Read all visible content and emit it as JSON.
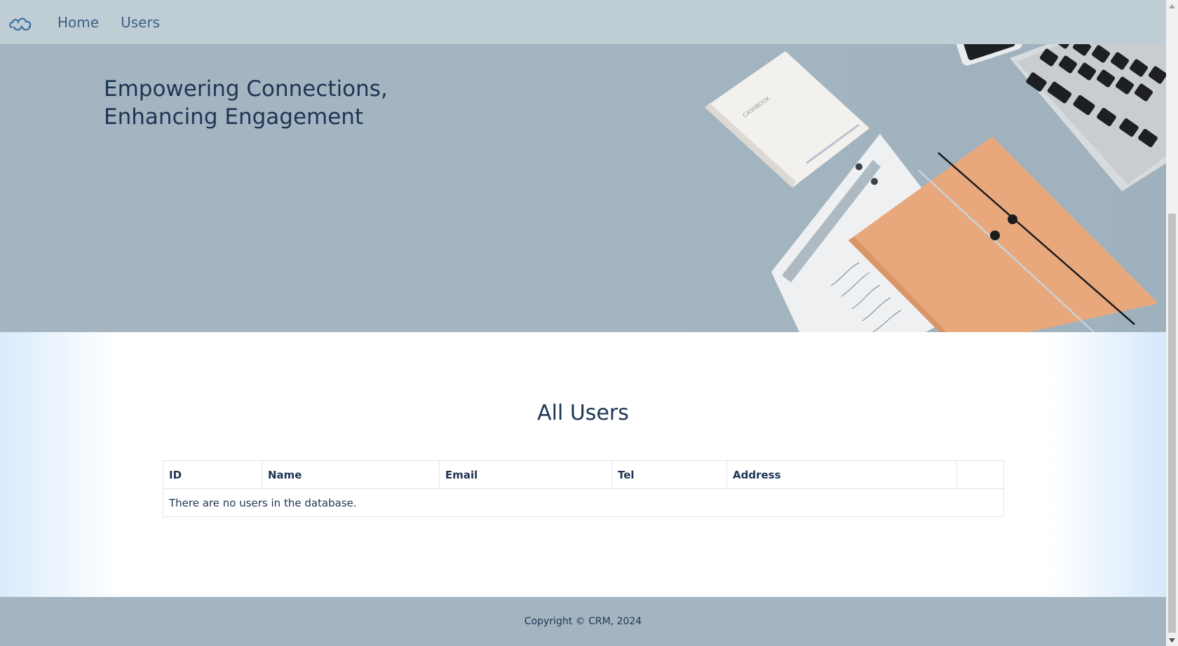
{
  "nav": {
    "logo_icon": "cloud-logo-icon",
    "links": [
      {
        "label": "Home"
      },
      {
        "label": "Users"
      }
    ]
  },
  "hero": {
    "title_line1": "Empowering Connections,",
    "title_line2": "Enhancing Engagement",
    "image": "desk-flatlay-image"
  },
  "users_section": {
    "title": "All Users",
    "columns": [
      "ID",
      "Name",
      "Email",
      "Tel",
      "Address",
      ""
    ],
    "empty_message": "There are no users in the database."
  },
  "footer": {
    "copyright": "Copyright © CRM, 2024"
  },
  "colors": {
    "nav_bg": "#bfcdd5",
    "hero_bg": "#a4b5c1",
    "heading_text": "#1e3553",
    "nav_link": "#3d5f87"
  }
}
